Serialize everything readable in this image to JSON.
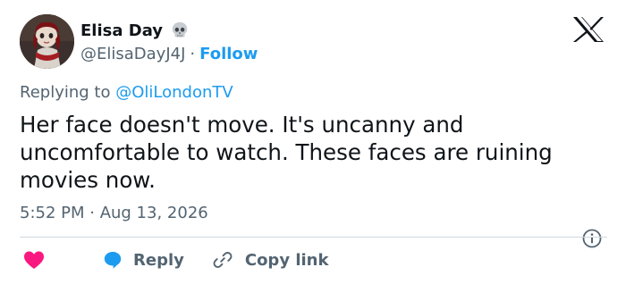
{
  "author": {
    "display_name": "Elisa Day",
    "emoji": "skull-icon",
    "handle": "@ElisaDayJ4J",
    "separator": "·",
    "follow_label": "Follow"
  },
  "reply": {
    "prefix": "Replying to",
    "mention": "@OliLondonTV"
  },
  "tweet": {
    "text": "Her face doesn't move. It's uncanny and uncomfortable to watch. These faces are ruining movies now.",
    "timestamp": "5:52 PM · Aug 13, 2026"
  },
  "actions": {
    "like_icon": "heart-icon",
    "reply_label": "Reply",
    "copy_link_label": "Copy link"
  },
  "colors": {
    "accent": "#1d9bf0",
    "like": "#f91880",
    "text": "#0f1419",
    "muted": "#536471",
    "divider": "#cfd9de"
  }
}
